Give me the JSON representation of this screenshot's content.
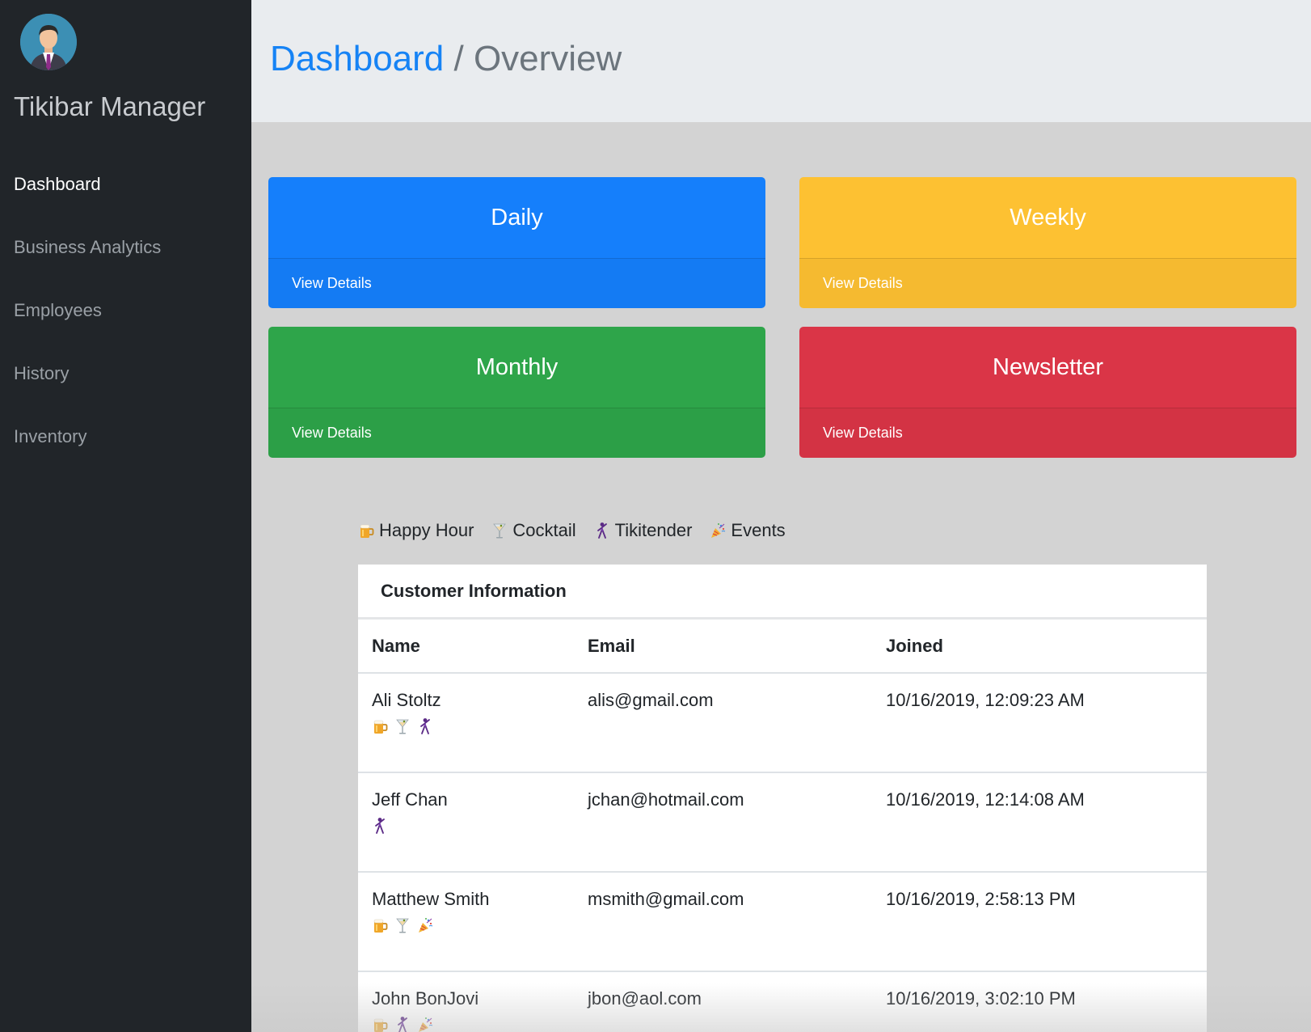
{
  "app": {
    "title": "Tikibar Manager"
  },
  "sidebar": {
    "items": [
      {
        "label": "Dashboard",
        "active": true
      },
      {
        "label": "Business Analytics"
      },
      {
        "label": "Employees"
      },
      {
        "label": "History"
      },
      {
        "label": "Inventory"
      }
    ]
  },
  "header": {
    "breadcrumb_link": "Dashboard",
    "breadcrumb_separator": " / ",
    "breadcrumb_current": "Overview"
  },
  "cards": [
    {
      "title": "Daily",
      "footer": "View Details",
      "color": "#157ffb"
    },
    {
      "title": "Weekly",
      "footer": "View Details",
      "color": "#fdc132"
    },
    {
      "title": "Monthly",
      "footer": "View Details",
      "color": "#2ea54a"
    },
    {
      "title": "Newsletter",
      "footer": "View Details",
      "color": "#da3547"
    }
  ],
  "legend": [
    {
      "label": "Happy Hour",
      "icon": "beer-mug-icon"
    },
    {
      "label": "Cocktail",
      "icon": "cocktail-glass-icon"
    },
    {
      "label": "Tikitender",
      "icon": "dancer-icon"
    },
    {
      "label": "Events",
      "icon": "party-popper-icon"
    }
  ],
  "customers": {
    "title": "Customer Information",
    "columns": [
      "Name",
      "Email",
      "Joined"
    ],
    "rows": [
      {
        "name": "Ali Stoltz",
        "email": "alis@gmail.com",
        "joined": "10/16/2019, 12:09:23 AM",
        "tags": [
          "beer-mug-icon",
          "cocktail-glass-icon",
          "dancer-icon"
        ]
      },
      {
        "name": "Jeff Chan",
        "email": "jchan@hotmail.com",
        "joined": "10/16/2019, 12:14:08 AM",
        "tags": [
          "dancer-icon"
        ]
      },
      {
        "name": "Matthew Smith",
        "email": "msmith@gmail.com",
        "joined": "10/16/2019, 2:58:13 PM",
        "tags": [
          "beer-mug-icon",
          "cocktail-glass-icon",
          "party-popper-icon"
        ]
      },
      {
        "name": "John BonJovi",
        "email": "jbon@aol.com",
        "joined": "10/16/2019, 3:02:10 PM",
        "tags": [
          "beer-mug-icon",
          "dancer-icon",
          "party-popper-icon"
        ]
      }
    ]
  }
}
